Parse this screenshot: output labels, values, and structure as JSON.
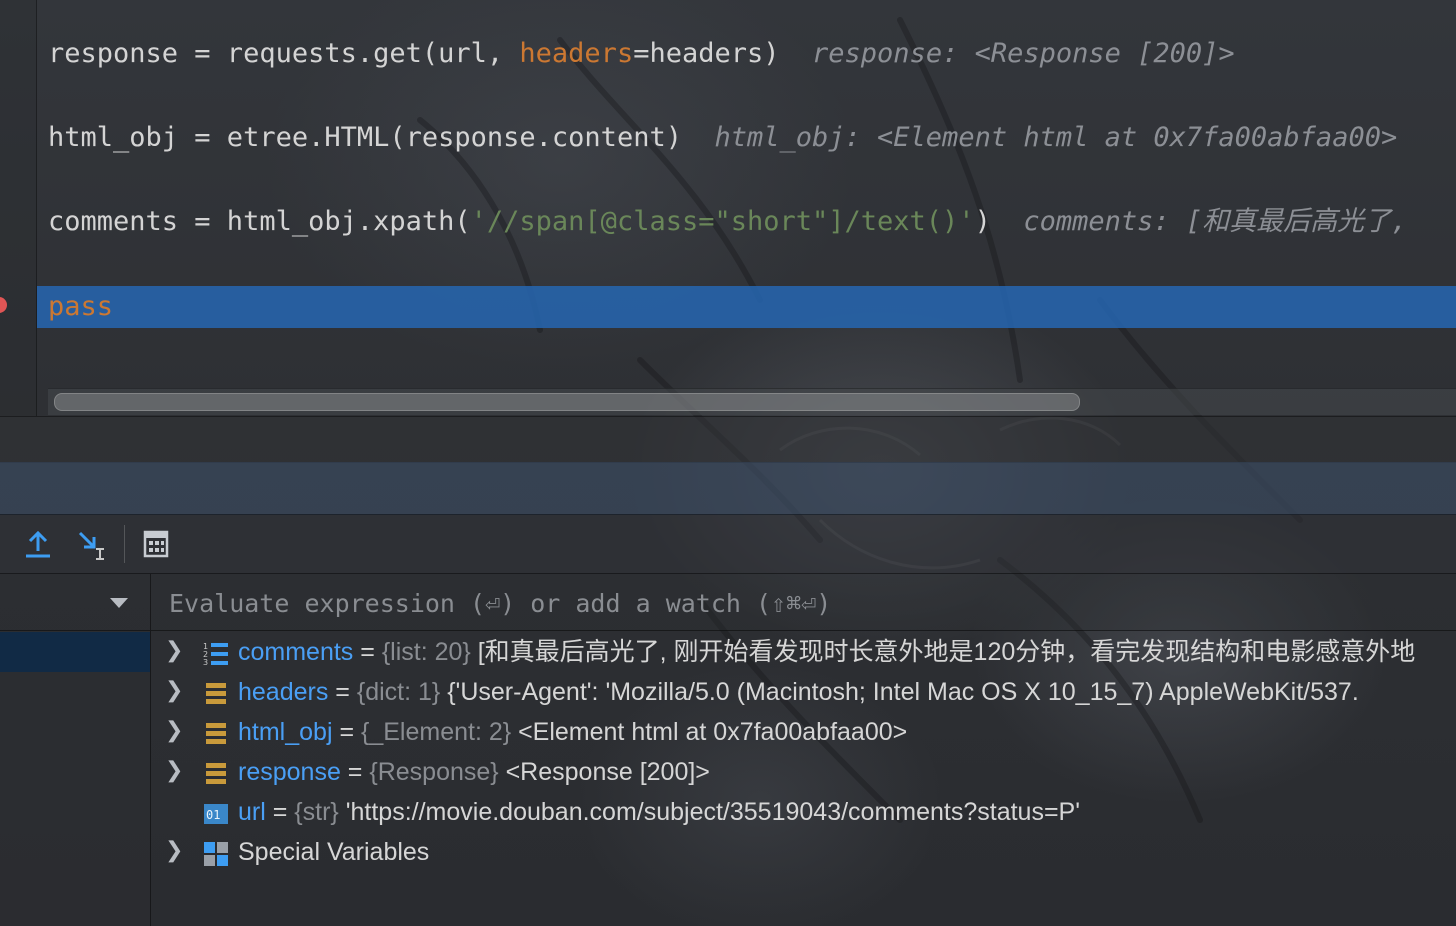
{
  "editor": {
    "lines": [
      {
        "parts": [
          "response = requests.get(url, ",
          "headers",
          "=headers)"
        ],
        "inlay": "response: <Response [200]>"
      },
      {
        "parts": [
          "html_obj = etree.HTML(response.content)"
        ],
        "inlay": "html_obj: <Element html at 0x7fa00abfaa00>"
      },
      {
        "parts": [
          "comments = html_obj.xpath(",
          "'//span[@class=\"short\"]/text()'",
          ")"
        ],
        "inlay": "comments: [和真最后高光了,"
      },
      {
        "parts": [
          "pass"
        ]
      }
    ]
  },
  "toolbar": {
    "icons": [
      "export-up-icon",
      "step-into-icon",
      "calculator-icon"
    ]
  },
  "evaluate": {
    "placeholder": "Evaluate expression (⏎) or add a watch (⇧⌘⏎)"
  },
  "variables": [
    {
      "name": "comments",
      "eq": " = ",
      "type": "{list: 20}",
      "value": " [和真最后高光了, 刚开始看发现时长意外地是120分钟，看完发现结构和电影感意外地",
      "icon": "list-icon",
      "expandable": true
    },
    {
      "name": "headers",
      "eq": " = ",
      "type": "{dict: 1}",
      "value": " {'User-Agent': 'Mozilla/5.0 (Macintosh; Intel Mac OS X 10_15_7) AppleWebKit/537.",
      "icon": "object-icon",
      "expandable": true
    },
    {
      "name": "html_obj",
      "eq": " = ",
      "type": "{_Element: 2}",
      "value": " <Element html at 0x7fa00abfaa00>",
      "icon": "object-icon",
      "expandable": true
    },
    {
      "name": "response",
      "eq": " = ",
      "type": "{Response}",
      "value": " <Response [200]>",
      "icon": "object-icon",
      "expandable": true
    },
    {
      "name": "url",
      "eq": " = ",
      "type": "{str}",
      "value": " 'https://movie.douban.com/subject/35519043/comments?status=P'",
      "icon": "string-icon",
      "expandable": false
    },
    {
      "name": "Special Variables",
      "eq": "",
      "type": "",
      "value": "",
      "icon": "special-variables-icon",
      "expandable": true
    }
  ]
}
